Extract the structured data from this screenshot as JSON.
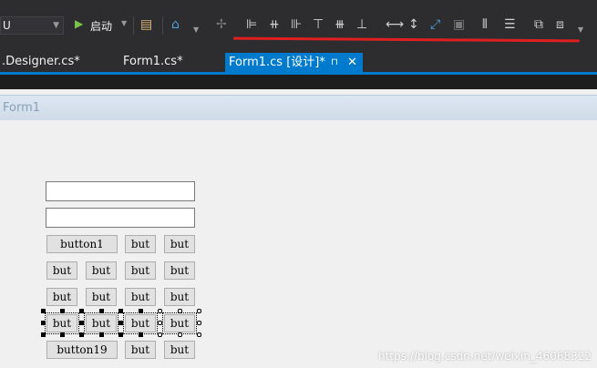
{
  "toolbar": {
    "config_combo": "U",
    "start_label": "启动"
  },
  "tabs": {
    "designer_cs": ".Designer.cs*",
    "form1_cs": "Form1.cs*",
    "active": "Form1.cs [设计]*",
    "pin": "⊓",
    "close": "✕"
  },
  "form": {
    "title": "Form1",
    "buttons": {
      "button1": "button1",
      "but": "but",
      "button19": "button19"
    }
  },
  "watermark": "https://blog.csdn.net/weixin_46068322",
  "colors": {
    "accent": "#007acc",
    "annotation": "#e02020"
  }
}
